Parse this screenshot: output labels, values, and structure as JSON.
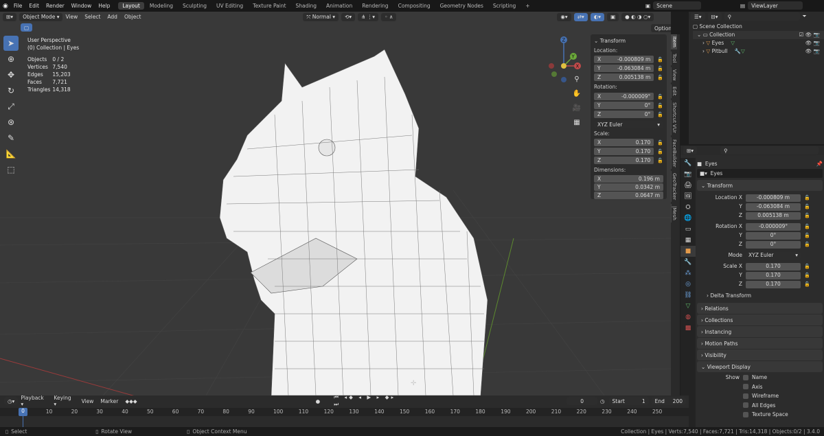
{
  "app": {
    "menus": [
      "File",
      "Edit",
      "Render",
      "Window",
      "Help"
    ],
    "workspaces": [
      "Layout",
      "Modeling",
      "Sculpting",
      "UV Editing",
      "Texture Paint",
      "Shading",
      "Animation",
      "Rendering",
      "Compositing",
      "Geometry Nodes",
      "Scripting"
    ],
    "scene": "Scene",
    "view_layer": "ViewLayer"
  },
  "viewport": {
    "mode": "Object Mode",
    "menus": [
      "View",
      "Select",
      "Add",
      "Object"
    ],
    "orientation": "Normal",
    "options": "Options",
    "perspective": "User Perspective",
    "collection": "(0) Collection | Eyes",
    "stats": [
      {
        "k": "Objects",
        "v": "0 / 2"
      },
      {
        "k": "Vertices",
        "v": "7,540"
      },
      {
        "k": "Edges",
        "v": "15,203"
      },
      {
        "k": "Faces",
        "v": "7,721"
      },
      {
        "k": "Triangles",
        "v": "14,318"
      }
    ],
    "gizmo": {
      "z": "Z",
      "x": "X",
      "y": "Y"
    }
  },
  "npanel": {
    "title": "Transform",
    "location_label": "Location:",
    "location": [
      {
        "a": "X",
        "v": "-0.000809 m"
      },
      {
        "a": "Y",
        "v": "-0.063084 m"
      },
      {
        "a": "Z",
        "v": "0.005138 m"
      }
    ],
    "rotation_label": "Rotation:",
    "rotation": [
      {
        "a": "X",
        "v": "-0.000009°"
      },
      {
        "a": "Y",
        "v": "0°"
      },
      {
        "a": "Z",
        "v": "0°"
      }
    ],
    "rotation_mode": "XYZ Euler",
    "scale_label": "Scale:",
    "scale": [
      {
        "a": "X",
        "v": "0.170"
      },
      {
        "a": "Y",
        "v": "0.170"
      },
      {
        "a": "Z",
        "v": "0.170"
      }
    ],
    "dimensions_label": "Dimensions:",
    "dimensions": [
      {
        "a": "X",
        "v": "0.196 m"
      },
      {
        "a": "Y",
        "v": "0.0342 m"
      },
      {
        "a": "Z",
        "v": "0.0647 m"
      }
    ],
    "tabs": [
      "Item",
      "Tool",
      "View",
      "Edit",
      "Shortcut VUr",
      "FaceBuilder",
      "GeoTracker",
      "|Mesh"
    ]
  },
  "outliner": {
    "root": "Scene Collection",
    "collection": "Collection",
    "items": [
      "Eyes",
      "Pitbull"
    ]
  },
  "props": {
    "object_name": "Eyes",
    "data_name": "Eyes",
    "transform": "Transform",
    "location": [
      {
        "l": "Location X",
        "v": "-0.000809 m"
      },
      {
        "l": "Y",
        "v": "-0.063084 m"
      },
      {
        "l": "Z",
        "v": "0.005138 m"
      }
    ],
    "rotation": [
      {
        "l": "Rotation X",
        "v": "-0.000009°"
      },
      {
        "l": "Y",
        "v": "0°"
      },
      {
        "l": "Z",
        "v": "0°"
      }
    ],
    "mode_label": "Mode",
    "mode": "XYZ Euler",
    "scale": [
      {
        "l": "Scale X",
        "v": "0.170"
      },
      {
        "l": "Y",
        "v": "0.170"
      },
      {
        "l": "Z",
        "v": "0.170"
      }
    ],
    "delta": "Delta Transform",
    "sections": [
      "Relations",
      "Collections",
      "Instancing",
      "Motion Paths",
      "Visibility"
    ],
    "viewport_display": "Viewport Display",
    "show_label": "Show",
    "show_opts": [
      "Name",
      "Axis",
      "Wireframe",
      "All Edges",
      "Texture Space"
    ]
  },
  "timeline": {
    "menus": [
      "Playback",
      "Keying",
      "View",
      "Marker"
    ],
    "current": "0",
    "start_label": "Start",
    "start": "1",
    "end_label": "End",
    "end": "200",
    "ticks": [
      "0",
      "10",
      "20",
      "30",
      "40",
      "50",
      "60",
      "70",
      "80",
      "90",
      "100",
      "110",
      "120",
      "130",
      "140",
      "150",
      "160",
      "170",
      "180",
      "190",
      "200",
      "210",
      "220",
      "230",
      "240",
      "250"
    ]
  },
  "status": {
    "select": "Select",
    "rotate": "Rotate View",
    "context": "Object Context Menu",
    "info": "Collection | Eyes | Verts:7,540 | Faces:7,721 | Tris:14,318 | Objects:0/2 | 3.4.0"
  }
}
